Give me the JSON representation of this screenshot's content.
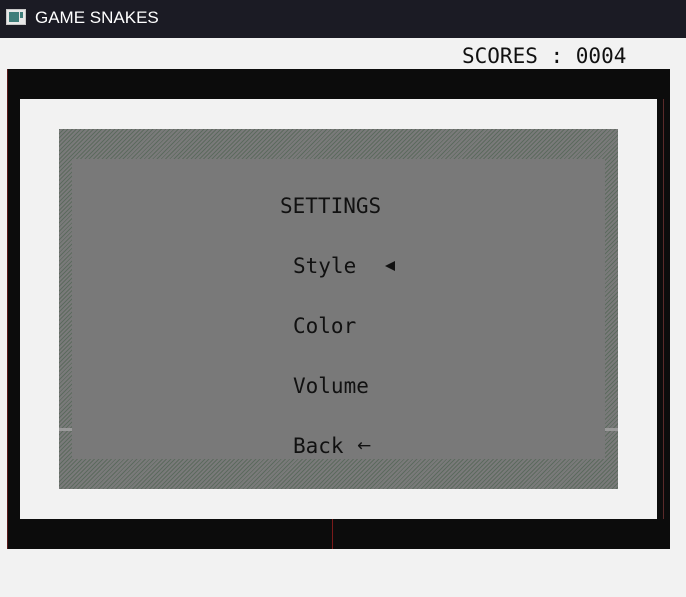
{
  "window": {
    "title": "GAME SNAKES"
  },
  "hud": {
    "scores": "SCORES : 0004"
  },
  "menu": {
    "title": "SETTINGS",
    "items": [
      {
        "label": "Style",
        "selected": true
      },
      {
        "label": "Color",
        "selected": false
      },
      {
        "label": "Volume",
        "selected": false
      },
      {
        "label": "Back",
        "selected": false
      }
    ],
    "selector_icon": "left-triangle-icon",
    "back_icon": "left-arrow-icon",
    "back_glyph": "←"
  },
  "colors": {
    "titlebar": "#1b1b24",
    "board_border": "#0c0c0c",
    "panel": "#797979",
    "text": "#111111"
  }
}
